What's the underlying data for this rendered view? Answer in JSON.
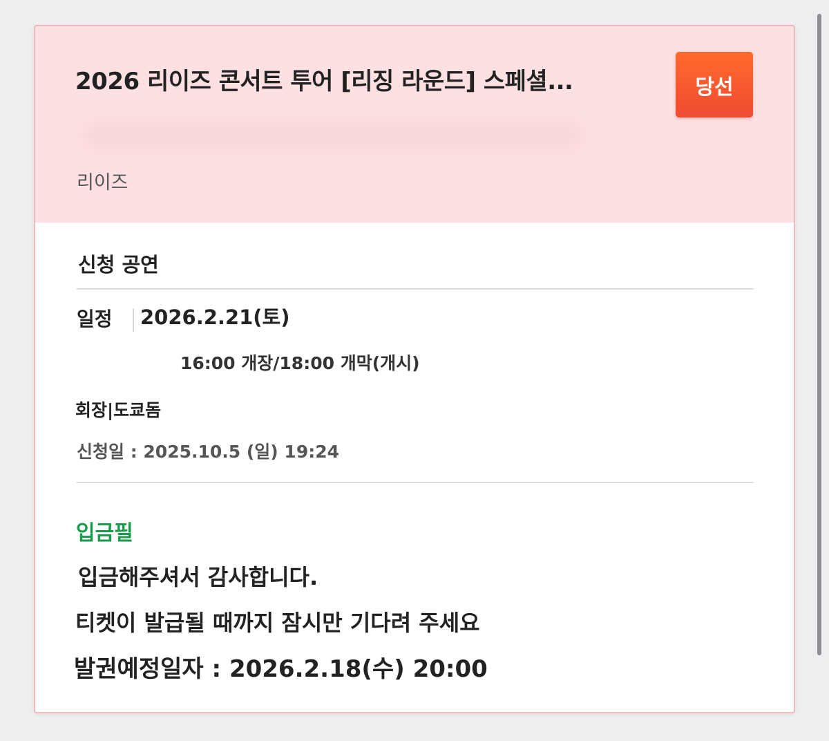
{
  "ticket": {
    "title": "2026 리이즈 콘서트 투어 [리징 라운드] 스페셜...",
    "artist": "리이즈",
    "result_badge": "당선",
    "section_title": "신청 공연",
    "schedule_label": "일정",
    "schedule_date": "2026.2.21(토)",
    "schedule_time": "16:00 개장/18:00 개막(개시)",
    "venue": "회장|도쿄돔",
    "applied_date": "신청일 : 2025.10.5 (일) 19:24",
    "payment_status": "입금필",
    "message_thanks": "입금해주셔서 감사합니다.",
    "message_wait": "티켓이 발급될 때까지 잠시만 기다려 주세요",
    "issue_date": "발권예정일자 : 2026.2.18(수) 20:00"
  },
  "colors": {
    "header_bg": "#fde0e2",
    "card_border": "#f2b9bc",
    "badge_bg": "#f45a2f",
    "status_green": "#1a9a4b",
    "page_bg": "#eeeef0"
  }
}
